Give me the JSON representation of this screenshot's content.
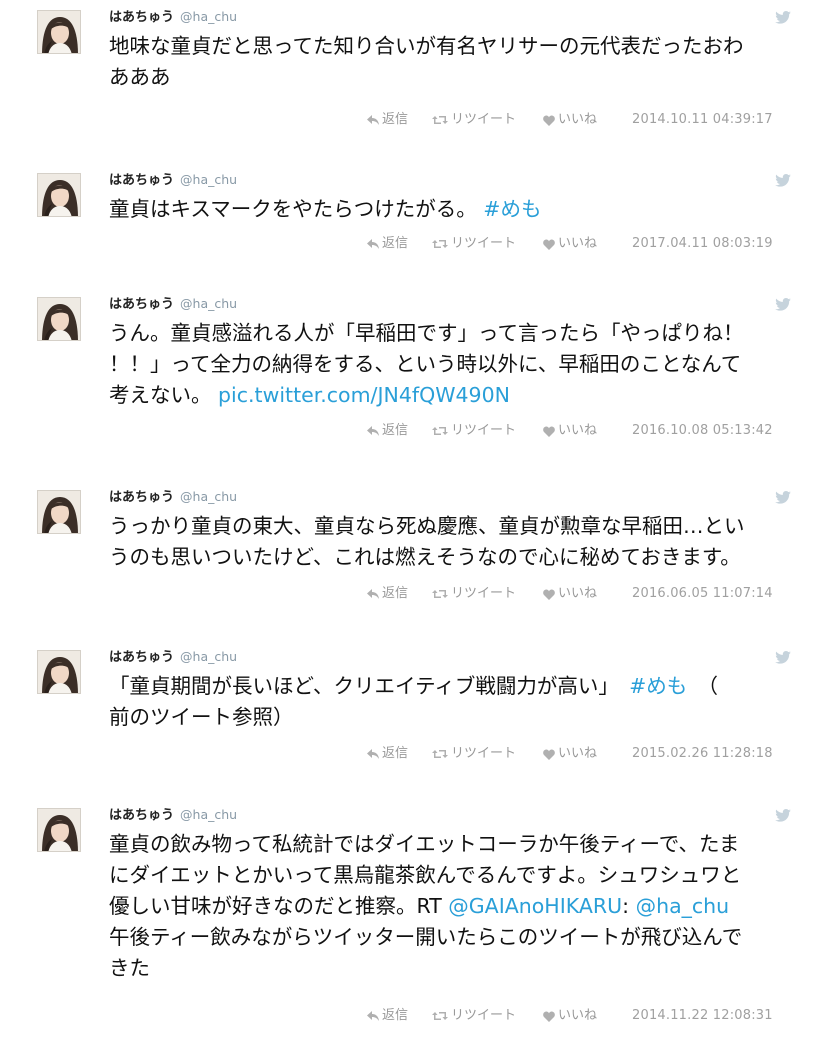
{
  "user": {
    "display_name": "はあちゅう",
    "screen_name": "@ha_chu"
  },
  "actions": {
    "reply": "返信",
    "retweet": "リツイート",
    "like": "いいね"
  },
  "colors": {
    "link": "#2a9fd8",
    "meta": "#999999",
    "handle": "#8899a6"
  },
  "icons": [
    "twitter-bird-icon",
    "reply-icon",
    "retweet-icon",
    "heart-icon"
  ],
  "tweets": [
    {
      "lines": [
        [
          {
            "t": "地味な童貞だと思ってた知り合いが有名ヤリサーの元代表だったおわ"
          }
        ],
        [
          {
            "t": "あああ"
          }
        ]
      ],
      "date": "2014.10.11 04:39:17"
    },
    {
      "lines": [
        [
          {
            "t": "童貞はキスマークをやたらつけたがる。 "
          },
          {
            "t": "#めも",
            "tag": true
          }
        ]
      ],
      "date": "2017.04.11 08:03:19"
    },
    {
      "lines": [
        [
          {
            "t": "うん。童貞感溢れる人が「早稲田です」って言ったら「やっぱりね！"
          }
        ],
        [
          {
            "t": "！！」って全力の納得をする、という時以外に、早稲田のことなんて"
          }
        ],
        [
          {
            "t": "考えない。 "
          },
          {
            "t": "pic.twitter.com/JN4fQW490N",
            "tag": true
          }
        ]
      ],
      "date": "2016.10.08 05:13:42"
    },
    {
      "lines": [
        [
          {
            "t": "うっかり童貞の東大、童貞なら死ぬ慶應、童貞が勲章な早稲田…とい"
          }
        ],
        [
          {
            "t": "うのも思いついたけど、これは燃えそうなので心に秘めておきます。"
          }
        ]
      ],
      "date": "2016.06.05 11:07:14"
    },
    {
      "lines": [
        [
          {
            "t": "「童貞期間が長いほど、クリエイティブ戦闘力が高い」　"
          },
          {
            "t": "#めも",
            "tag": true
          },
          {
            "t": "　（"
          }
        ],
        [
          {
            "t": "前のツイート参照）"
          }
        ]
      ],
      "date": "2015.02.26 11:28:18"
    },
    {
      "lines": [
        [
          {
            "t": "童貞の飲み物って私統計ではダイエットコーラか午後ティーで、たま"
          }
        ],
        [
          {
            "t": "にダイエットとかいって黒烏龍茶飲んでるんですよ。シュワシュワと"
          }
        ],
        [
          {
            "t": "優しい甘味が好きなのだと推察。RT "
          },
          {
            "t": "@GAIAnoHIKARU",
            "tag": true
          },
          {
            "t": ": "
          },
          {
            "t": "@ha_chu",
            "tag": true
          }
        ],
        [
          {
            "t": "午後ティー飲みながらツイッター開いたらこのツイートが飛び込んで"
          }
        ],
        [
          {
            "t": "きた"
          }
        ]
      ],
      "date": "2014.11.22 12:08:31"
    }
  ]
}
